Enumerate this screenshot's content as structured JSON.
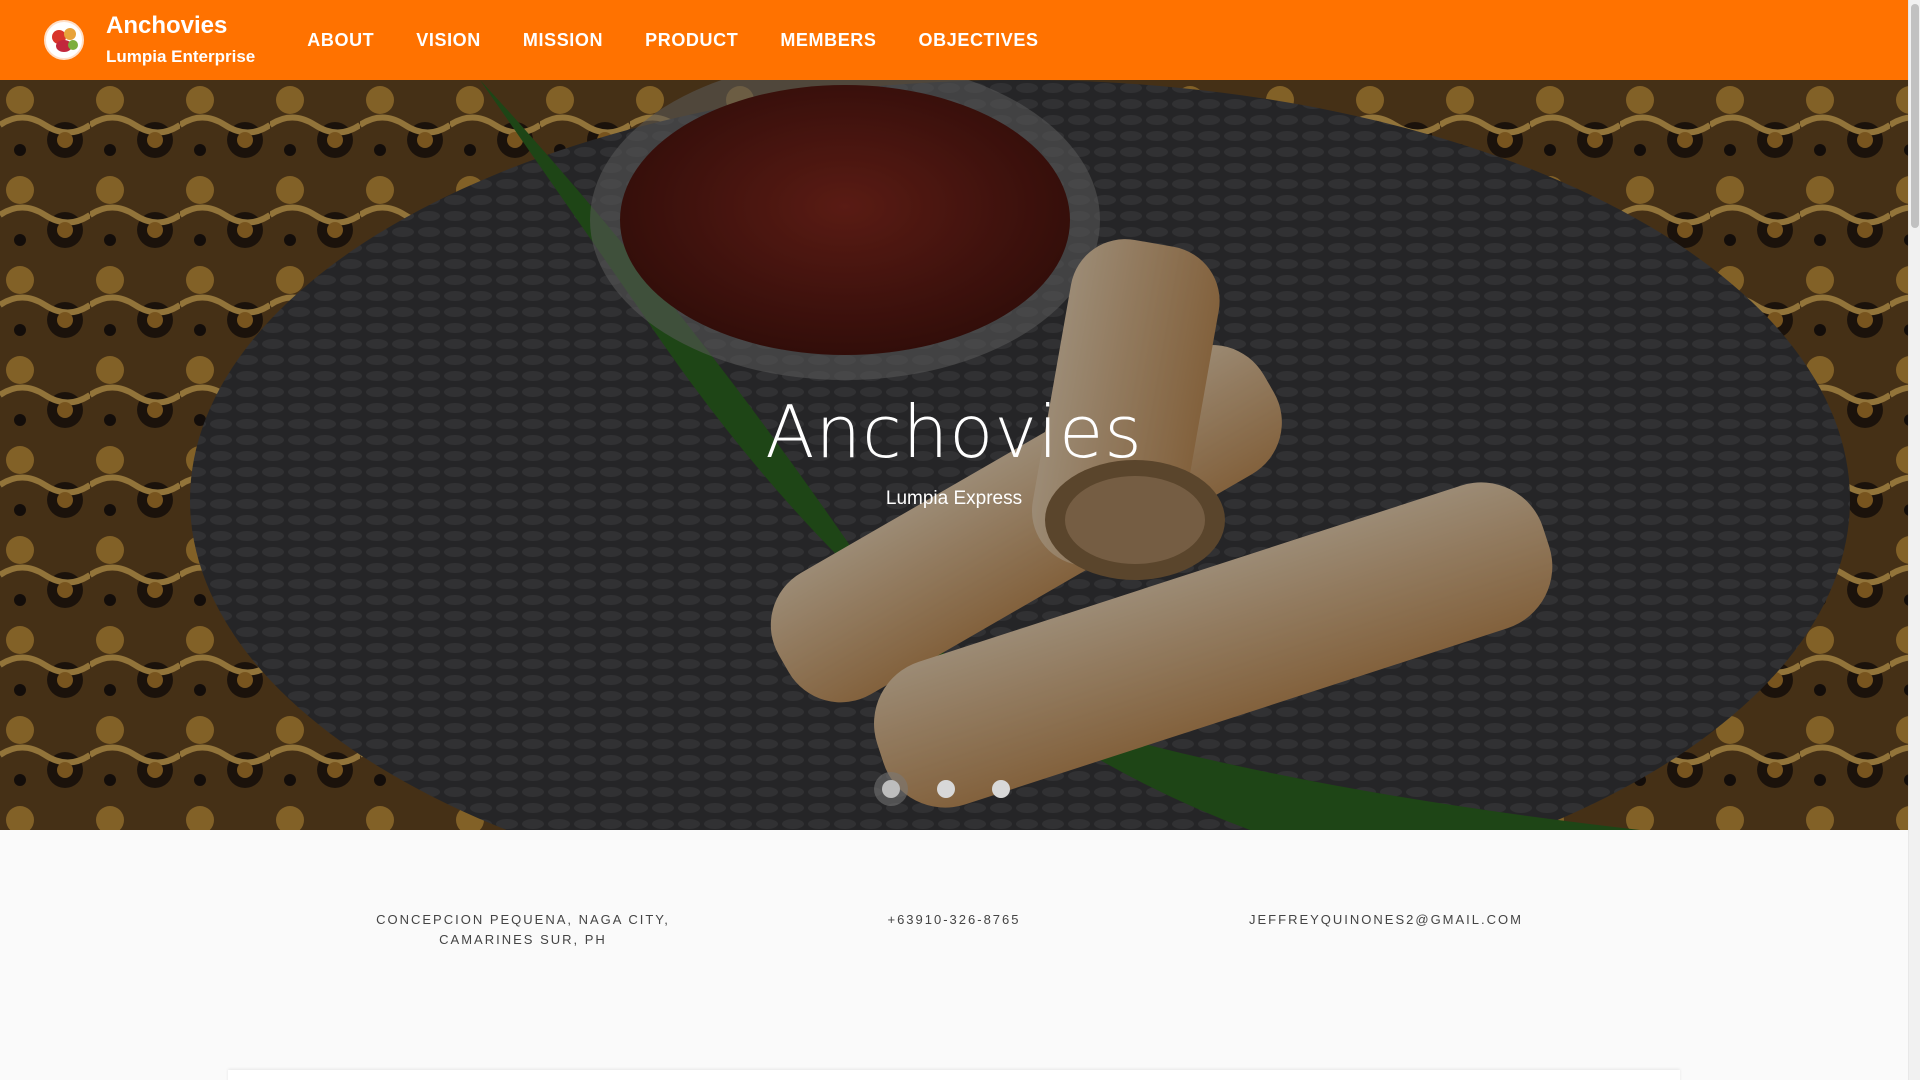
{
  "header": {
    "brand_name": "Anchovies",
    "brand_subtitle": "Lumpia Enterprise",
    "logo_icon": "lumpia-logo-icon",
    "accent_color": "#ff7200",
    "nav": [
      "ABOUT",
      "VISION",
      "MISSION",
      "PRODUCT",
      "MEMBERS",
      "OBJECTIVES"
    ]
  },
  "hero": {
    "title": "Anchovies",
    "subtitle": "Lumpia Express",
    "slides_total": 3,
    "active_slide": 1
  },
  "contact": {
    "address": "CONCEPCION PEQUENA, NAGA CITY, CAMARINES SUR, PH",
    "phone": "+63910-326-8765",
    "email": "JEFFREYQUINONES2@GMAIL.COM"
  }
}
